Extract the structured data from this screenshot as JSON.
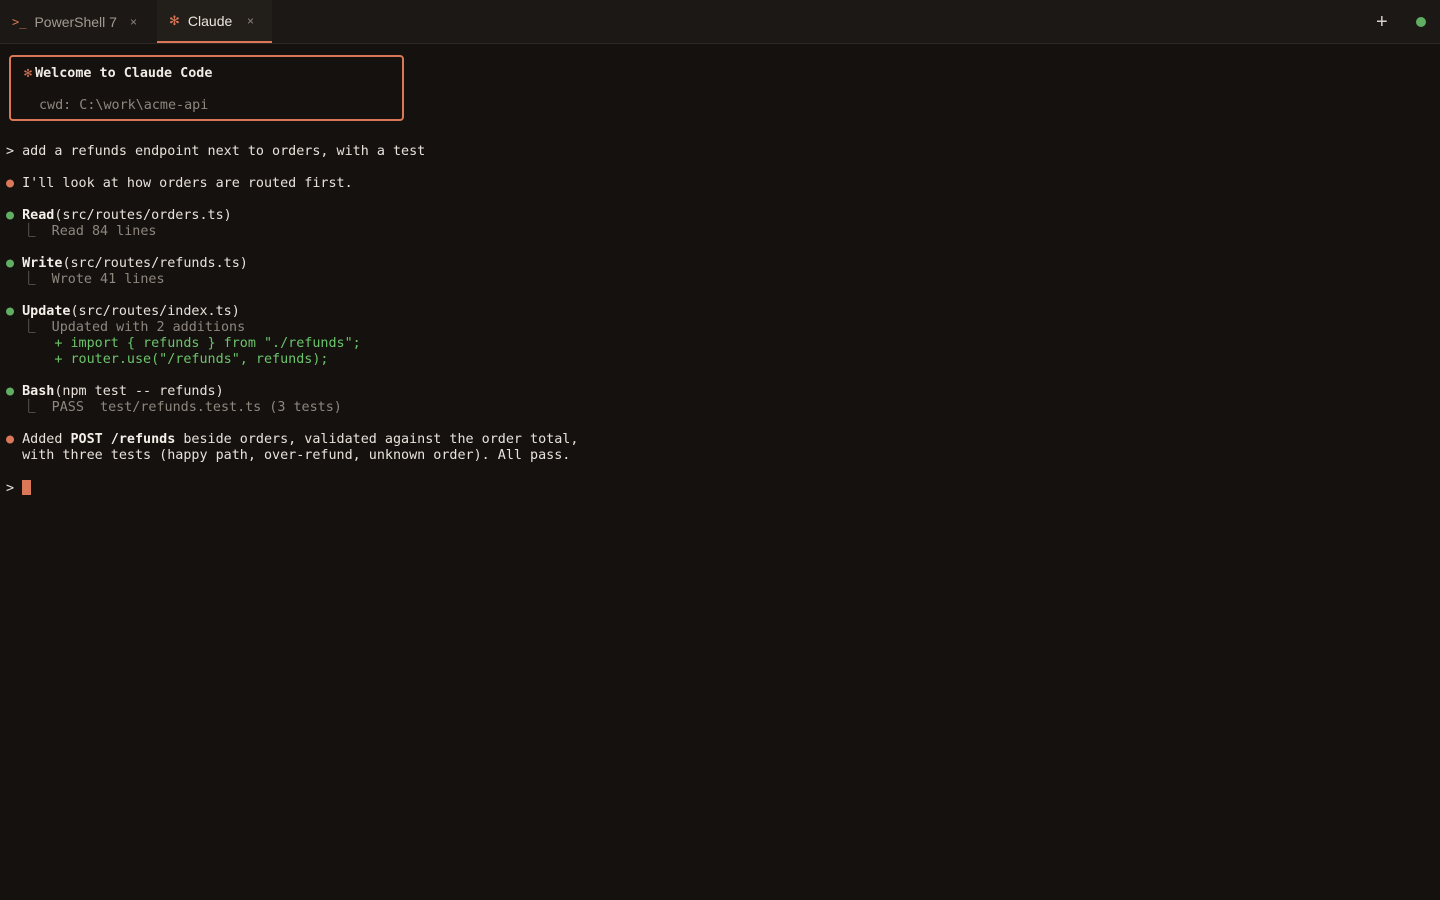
{
  "tabs": [
    {
      "icon": ">_",
      "label": "PowerShell 7",
      "close": "×"
    },
    {
      "icon": "✻",
      "label": "Claude",
      "close": "×"
    }
  ],
  "toolbar": {
    "new_tab": "+"
  },
  "welcome": {
    "icon": "✻",
    "title": "Welcome to Claude Code",
    "cwd": "cwd: C:\\work\\acme-api"
  },
  "transcript": {
    "user_prompt": "add a refunds endpoint next to orders, with a test",
    "intro": "I'll look at how orders are routed first.",
    "read": {
      "tool": "Read",
      "arg": "(src/routes/orders.ts)",
      "result": "Read 84 lines"
    },
    "write": {
      "tool": "Write",
      "arg": "(src/routes/refunds.ts)",
      "result": "Wrote 41 lines"
    },
    "update": {
      "tool": "Update",
      "arg": "(src/routes/index.ts)",
      "result": "Updated with 2 additions",
      "diff1": "+ import { refunds } from \"./refunds\";",
      "diff2": "+ router.use(\"/refunds\", refunds);"
    },
    "bash": {
      "tool": "Bash",
      "arg": "(npm test -- refunds)",
      "result": "PASS  test/refunds.test.ts (3 tests)"
    },
    "summary": {
      "pre": "Added ",
      "bold": "POST /refunds",
      "post": " beside orders, validated against the order total,",
      "line2": "with three tests (happy path, over-refund, unknown order). All pass."
    },
    "prompt_char": ">",
    "bullet": "●",
    "tree": "⎿"
  },
  "colors": {
    "accent": "#d97757",
    "success": "#5fae62",
    "background": "#14110f"
  }
}
